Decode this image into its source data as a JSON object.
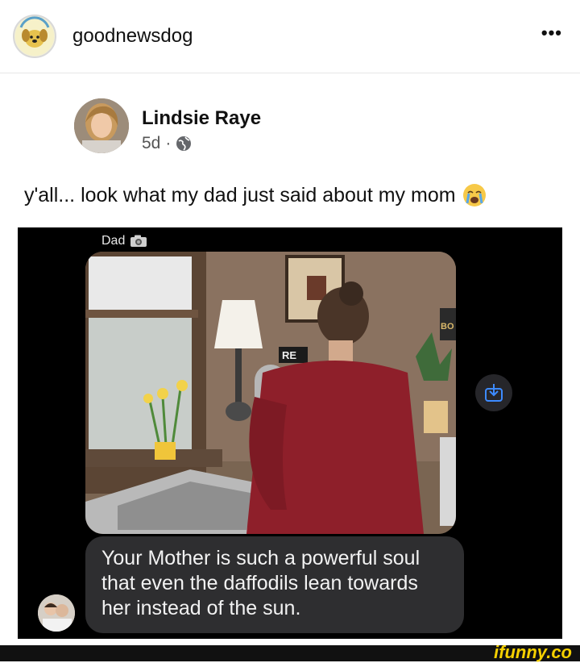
{
  "header": {
    "username": "goodnewsdog",
    "more_label": "•••",
    "logo_text": "GOOD NEWS DOG"
  },
  "post": {
    "author": "Lindsie Raye",
    "age": "5d",
    "separator": "·",
    "caption": "y'all... look what my dad just said about my mom"
  },
  "message": {
    "contact": "Dad",
    "bubble_text": "Your Mother is such a powerful soul that even the daffodils lean towards her instead of the sun.",
    "photo_signs": [
      "RE",
      "BO"
    ]
  },
  "footer": {
    "watermark": "ifunny.co"
  }
}
